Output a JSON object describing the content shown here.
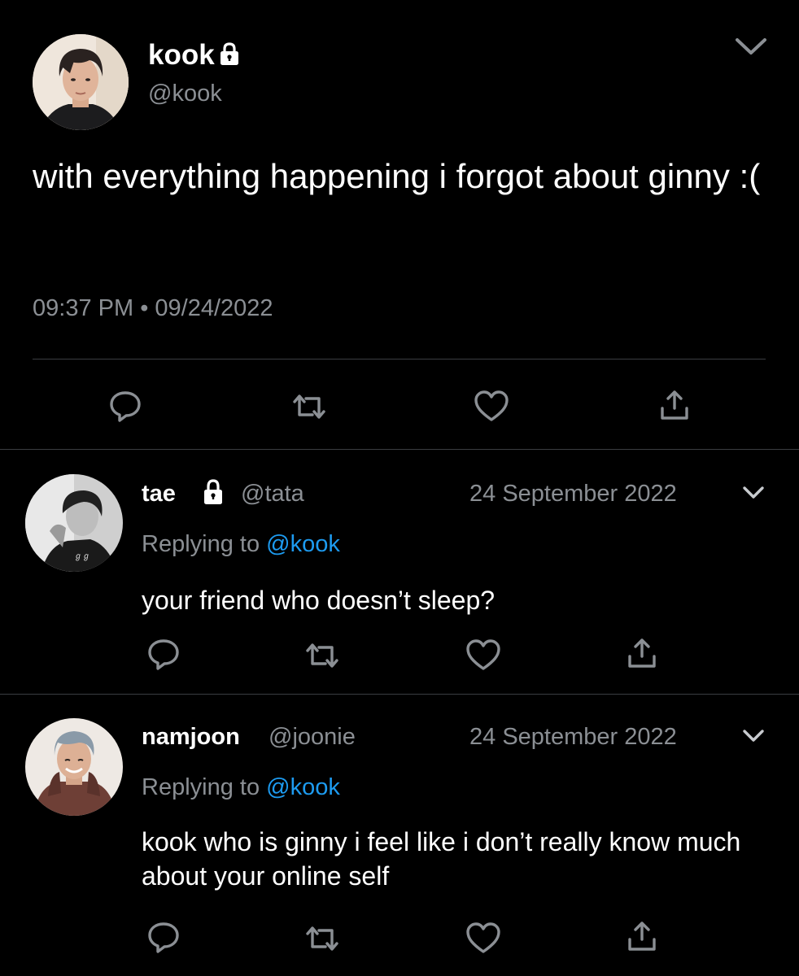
{
  "main_tweet": {
    "display_name": "kook",
    "handle": "@kook",
    "text": "with everything happening i forgot about ginny :(",
    "time": "09:37 PM",
    "separator": "•",
    "date": "09/24/2022",
    "actions": [
      "reply-icon",
      "retweet-icon",
      "like-icon",
      "share-icon"
    ]
  },
  "replies": [
    {
      "display_name": "tae",
      "handle": "@tata",
      "date": "24 September 2022",
      "replying_prefix": "Replying to",
      "replying_mention": "@kook",
      "text": "your friend who doesn’t sleep?"
    },
    {
      "display_name": "namjoon",
      "handle": "@joonie",
      "date": "24 September 2022",
      "replying_prefix": "Replying to",
      "replying_mention": "@kook",
      "text": "kook who is ginny i feel like i don’t really know much about your online self"
    }
  ],
  "colors": {
    "background": "#000000",
    "primary_text": "#ffffff",
    "secondary_text": "#8b8f94",
    "mention": "#1d9bf0",
    "divider": "#3a3d41"
  }
}
